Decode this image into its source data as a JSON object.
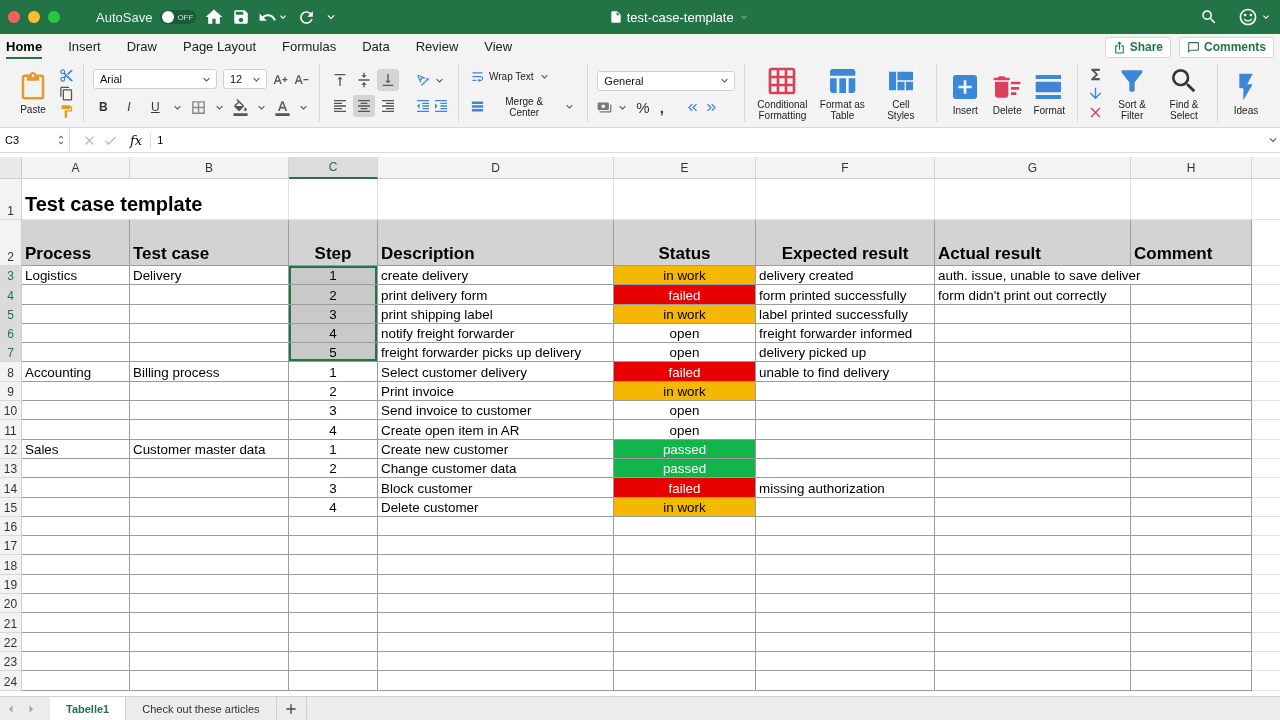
{
  "titlebar": {
    "autosave": {
      "label": "AutoSave",
      "on": false,
      "state_text": "OFF"
    },
    "title": "test-case-template"
  },
  "ribbon_tabs": [
    {
      "label": "Home",
      "selected": true
    },
    {
      "label": "Insert",
      "selected": false
    },
    {
      "label": "Draw",
      "selected": false
    },
    {
      "label": "Page Layout",
      "selected": false
    },
    {
      "label": "Formulas",
      "selected": false
    },
    {
      "label": "Data",
      "selected": false
    },
    {
      "label": "Review",
      "selected": false
    },
    {
      "label": "View",
      "selected": false
    }
  ],
  "share_button": "Share",
  "comments_button": "Comments",
  "ribbon": {
    "paste_label": "Paste",
    "font_name": "Arial",
    "font_size": "12",
    "text_styles": [
      "B",
      "I",
      "U"
    ],
    "vertical_align": [
      {
        "selected": false
      },
      {
        "selected": false
      },
      {
        "selected": true
      }
    ],
    "horizontal_align": [
      {
        "selected": false
      },
      {
        "selected": true
      },
      {
        "selected": false
      }
    ],
    "wrap_text": "Wrap Text",
    "merge_center": "Merge & Center",
    "number_format": "General",
    "percent": "%",
    "comma": ",",
    "style_commands": [
      {
        "kind": "conditional",
        "label": "Conditional Formatting"
      },
      {
        "kind": "table",
        "label": "Format as Table"
      },
      {
        "kind": "styles",
        "label": "Cell Styles"
      }
    ],
    "cell_commands": [
      {
        "kind": "insert",
        "label": "Insert"
      },
      {
        "kind": "delete",
        "label": "Delete"
      },
      {
        "kind": "format",
        "label": "Format"
      }
    ],
    "edit_commands": [
      {
        "kind": "sort",
        "label": "Sort & Filter"
      },
      {
        "kind": "find",
        "label": "Find & Select"
      }
    ],
    "ideas": "Ideas"
  },
  "formula_bar": {
    "cell": "C3",
    "fx": "fx",
    "value": "1"
  },
  "columns": [
    {
      "letter": "A",
      "selected": false
    },
    {
      "letter": "B",
      "selected": false
    },
    {
      "letter": "C",
      "selected": true
    },
    {
      "letter": "D",
      "selected": false
    },
    {
      "letter": "E",
      "selected": false
    },
    {
      "letter": "F",
      "selected": false
    },
    {
      "letter": "G",
      "selected": false
    },
    {
      "letter": "H",
      "selected": false
    }
  ],
  "title_row": {
    "number": "1",
    "text": "Test case template"
  },
  "header_row": {
    "number": "2",
    "cells": [
      "Process",
      "Test case",
      "Step",
      "Description",
      "Status",
      "Expected result",
      "Actual result",
      "Comment"
    ]
  },
  "rows": [
    {
      "number": "3",
      "selected": true,
      "process": "Logistics",
      "test_case": "Delivery",
      "step": "1",
      "description": "create delivery",
      "status": {
        "text": "in work",
        "color": "#f5b800"
      },
      "expected": "delivery created",
      "actual": "auth. issue, unable to save deliver"
    },
    {
      "number": "4",
      "selected": true,
      "step": "2",
      "description": "print delivery form",
      "status": {
        "text": "failed",
        "color": "#e60000"
      },
      "expected": "form printed successfully",
      "actual": "form didn't print out correctly"
    },
    {
      "number": "5",
      "selected": true,
      "step": "3",
      "description": "print shipping label",
      "status": {
        "text": "in work",
        "color": "#f5b800"
      },
      "expected": "label printed successfully"
    },
    {
      "number": "6",
      "selected": true,
      "step": "4",
      "description": "notify freight forwarder",
      "status": {
        "text": "open"
      },
      "expected": "freight forwarder informed"
    },
    {
      "number": "7",
      "selected": true,
      "step": "5",
      "description": "freight forwarder picks up delivery",
      "status": {
        "text": "open"
      },
      "expected": "delivery picked up"
    },
    {
      "number": "8",
      "selected": false,
      "process": "Accounting",
      "test_case": "Billing process",
      "step": "1",
      "description": "Select customer delivery",
      "status": {
        "text": "failed",
        "color": "#e60000"
      },
      "expected": "unable to find delivery"
    },
    {
      "number": "9",
      "selected": false,
      "step": "2",
      "description": "Print invoice",
      "status": {
        "text": "in work",
        "color": "#f5b800"
      }
    },
    {
      "number": "10",
      "selected": false,
      "step": "3",
      "description": "Send invoice to customer",
      "status": {
        "text": "open"
      }
    },
    {
      "number": "11",
      "selected": false,
      "step": "4",
      "description": "Create open item in AR",
      "status": {
        "text": "open"
      }
    },
    {
      "number": "12",
      "selected": false,
      "process": "Sales",
      "test_case": "Customer master data",
      "step": "1",
      "description": "Create new customer",
      "status": {
        "text": "passed",
        "color": "#12b54a"
      }
    },
    {
      "number": "13",
      "selected": false,
      "step": "2",
      "description": "Change customer data",
      "status": {
        "text": "passed",
        "color": "#12b54a"
      }
    },
    {
      "number": "14",
      "selected": false,
      "step": "3",
      "description": "Block customer",
      "status": {
        "text": "failed",
        "color": "#e60000"
      },
      "expected": "missing authorization"
    },
    {
      "number": "15",
      "selected": false,
      "step": "4",
      "description": "Delete customer",
      "status": {
        "text": "in work",
        "color": "#f5b800"
      }
    },
    {
      "number": "16",
      "selected": false
    },
    {
      "number": "17",
      "selected": false
    },
    {
      "number": "18",
      "selected": false
    },
    {
      "number": "19",
      "selected": false
    },
    {
      "number": "20",
      "selected": false
    },
    {
      "number": "21",
      "selected": false
    },
    {
      "number": "22",
      "selected": false
    },
    {
      "number": "23",
      "selected": false
    },
    {
      "number": "24",
      "selected": false
    }
  ],
  "sheet_tabs": [
    {
      "label": "Tabelle1",
      "selected": true
    },
    {
      "label": "Check out these articles",
      "selected": false
    }
  ]
}
